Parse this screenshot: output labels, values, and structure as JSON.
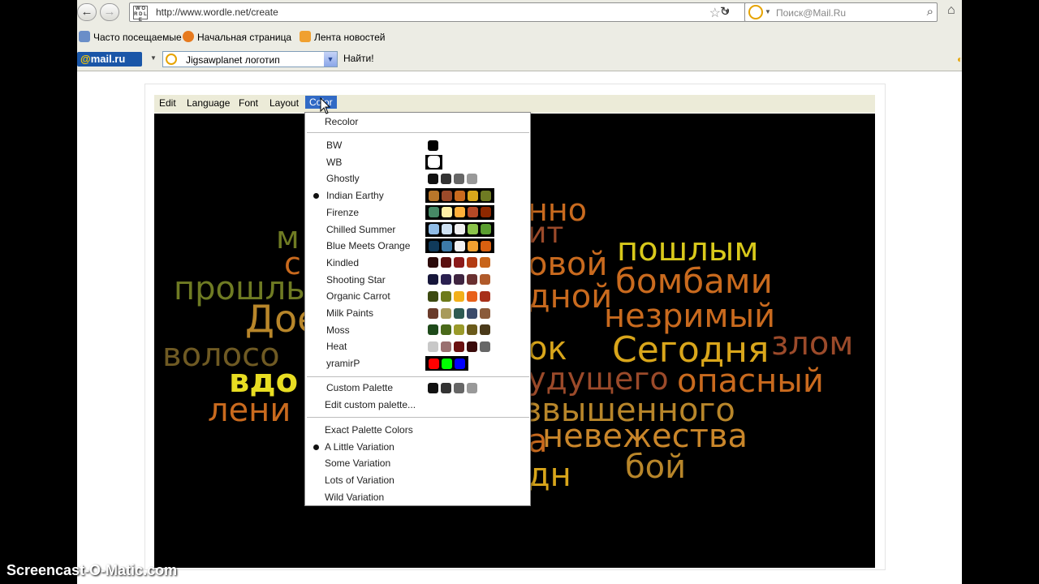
{
  "browser": {
    "url": "http://www.wordle.net/create",
    "favicon_text": "W O R D L E",
    "search_placeholder": "Поиск@Mail.Ru",
    "bookmarks": [
      "Часто посещаемые",
      "Начальная страница",
      "Лента новостей"
    ],
    "mail_logo_at": "@",
    "mail_logo_text": "mail.ru",
    "mail_search_value": "Jigsawplanet логотип",
    "find_button": "Найти!"
  },
  "app_menu": [
    "Edit",
    "Language",
    "Font",
    "Layout",
    "Color"
  ],
  "color_menu": {
    "recolor": "Recolor",
    "palettes": [
      {
        "name": "BW",
        "selected": false,
        "bg": "#ffffff",
        "colors": [
          "#000000"
        ]
      },
      {
        "name": "WB",
        "selected": false,
        "bg": "#000000",
        "colors": [
          "#ffffff"
        ]
      },
      {
        "name": "Ghostly",
        "selected": false,
        "bg": "#ffffff",
        "colors": [
          "#111111",
          "#333333",
          "#666666",
          "#999999"
        ]
      },
      {
        "name": "Indian Earthy",
        "selected": true,
        "bg": "#000000",
        "colors": [
          "#b8762a",
          "#9b4a2a",
          "#c96a1e",
          "#d9a61b",
          "#6f7b23"
        ]
      },
      {
        "name": "Firenze",
        "selected": false,
        "bg": "#000000",
        "colors": [
          "#468966",
          "#fff0a5",
          "#ffb03b",
          "#b64926",
          "#8e2800"
        ]
      },
      {
        "name": "Chilled Summer",
        "selected": false,
        "bg": "#000000",
        "colors": [
          "#8fbce6",
          "#cfe2f3",
          "#f0f0f0",
          "#8bc34a",
          "#5a9e2f"
        ]
      },
      {
        "name": "Blue Meets Orange",
        "selected": false,
        "bg": "#000000",
        "colors": [
          "#103a5a",
          "#3d7aa8",
          "#f2f2f2",
          "#f0a030",
          "#d86010"
        ]
      },
      {
        "name": "Kindled",
        "selected": false,
        "bg": "#ffffff",
        "colors": [
          "#2b0a0a",
          "#5a1010",
          "#8c1a1a",
          "#b33b12",
          "#c8641a"
        ]
      },
      {
        "name": "Shooting Star",
        "selected": false,
        "bg": "#ffffff",
        "colors": [
          "#16163a",
          "#2a2050",
          "#3f2440",
          "#6a3030",
          "#b05a2a"
        ]
      },
      {
        "name": "Organic Carrot",
        "selected": false,
        "bg": "#ffffff",
        "colors": [
          "#3c4a10",
          "#6d7a1a",
          "#f2b01a",
          "#e8601a",
          "#a8301a"
        ]
      },
      {
        "name": "Milk Paints",
        "selected": false,
        "bg": "#ffffff",
        "colors": [
          "#6a3b2a",
          "#a89a5a",
          "#2e5a52",
          "#3a4a6a",
          "#8a5a3a"
        ]
      },
      {
        "name": "Moss",
        "selected": false,
        "bg": "#ffffff",
        "colors": [
          "#1e4a1a",
          "#4a6a1a",
          "#9a9a2a",
          "#6a5a1a",
          "#4a3a1a"
        ]
      },
      {
        "name": "Heat",
        "selected": false,
        "bg": "#ffffff",
        "colors": [
          "#c8c8c8",
          "#9a7070",
          "#6a1010",
          "#3a0a0a",
          "#666666"
        ]
      },
      {
        "name": "yramirP",
        "selected": false,
        "bg": "#000000",
        "colors": [
          "#ff0000",
          "#00ff00",
          "#0000ff"
        ]
      }
    ],
    "custom_palette": {
      "name": "Custom Palette",
      "colors": [
        "#111111",
        "#333333",
        "#666666",
        "#999999"
      ]
    },
    "edit_custom": "Edit custom palette...",
    "variations": [
      {
        "label": "Exact Palette Colors",
        "selected": false
      },
      {
        "label": "A Little Variation",
        "selected": true
      },
      {
        "label": "Some Variation",
        "selected": false
      },
      {
        "label": "Lots of Variation",
        "selected": false
      },
      {
        "label": "Wild Variation",
        "selected": false
      }
    ]
  },
  "cloud_words": [
    {
      "text": "нно",
      "color": "#c96a1e"
    },
    {
      "text": "ит",
      "color": "#9b4a2a"
    },
    {
      "text": "пошлым",
      "color": "#d9c91b"
    },
    {
      "text": "м",
      "color": "#6f7b23"
    },
    {
      "text": "овой",
      "color": "#c96a1e"
    },
    {
      "text": "с",
      "color": "#c96a1e"
    },
    {
      "text": "бомбами",
      "color": "#c96a1e"
    },
    {
      "text": "прошлы",
      "color": "#6f7b23"
    },
    {
      "text": "дной",
      "color": "#c96a1e"
    },
    {
      "text": "незримый",
      "color": "#c96a1e"
    },
    {
      "text": "Дое",
      "color": "#b8862a"
    },
    {
      "text": "ок",
      "color": "#d9a61b"
    },
    {
      "text": "Сегодня",
      "color": "#d9a61b"
    },
    {
      "text": "злом",
      "color": "#9b4a2a"
    },
    {
      "text": "волосо",
      "color": "#6f5a23"
    },
    {
      "text": "удущего",
      "color": "#9b4a2a"
    },
    {
      "text": "опасный",
      "color": "#c96a1e"
    },
    {
      "text": "вдо",
      "color": "#e8dd22"
    },
    {
      "text": "лени",
      "color": "#c96a1e"
    },
    {
      "text": "звышенного",
      "color": "#b8862a"
    },
    {
      "text": "а",
      "color": "#c96a1e"
    },
    {
      "text": "невежества",
      "color": "#c9862a"
    },
    {
      "text": "бой",
      "color": "#b8862a"
    },
    {
      "text": "дн",
      "color": "#d9a61b"
    }
  ],
  "watermark": "Screencast-O-Matic.com"
}
